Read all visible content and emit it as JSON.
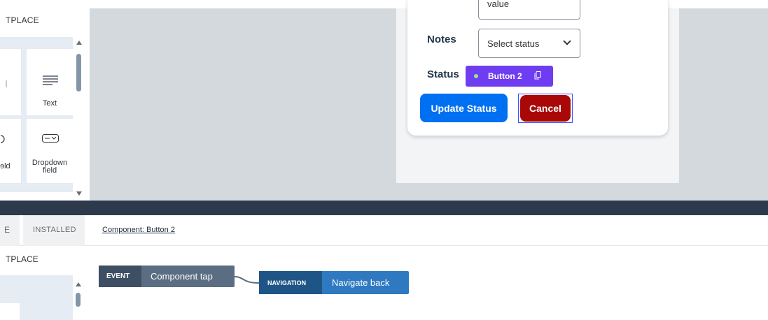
{
  "palette": {
    "title": "TPLACE",
    "items": [
      {
        "label": "",
        "icon": "text-icon"
      },
      {
        "label": "Text",
        "icon": "text-icon"
      },
      {
        "label": "ɘld",
        "icon": "input-icon"
      },
      {
        "label": "Dropdown field",
        "icon": "dropdown-icon"
      }
    ]
  },
  "form": {
    "value_field_text": "value",
    "notes_label": "Notes",
    "status_label": "Status",
    "select_text": "Select status",
    "selected_badge": "Button 2",
    "update_button": "Update Status",
    "cancel_button": "Cancel"
  },
  "bottom": {
    "tab_partial": "E",
    "tab_installed": "INSTALLED",
    "breadcrumb": "Component: Button 2",
    "rail_title": "TPLACE"
  },
  "flow": {
    "event_tag": "EVENT",
    "event_text": "Component tap",
    "nav_tag": "NAVIGATION",
    "nav_text": "Navigate back"
  },
  "colors": {
    "primary": "#0070f2",
    "cancel": "#aa0808",
    "selection": "#6e3df2",
    "divider": "#2c3a4b"
  }
}
